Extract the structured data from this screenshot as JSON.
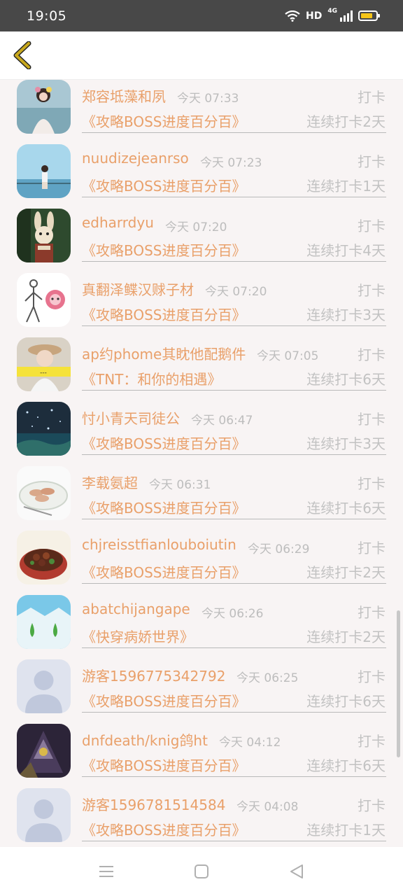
{
  "status_bar": {
    "time": "19:05",
    "network_label": "HD",
    "signal_label": "4G",
    "battery_level": 0.8,
    "battery_color": "#f5c518"
  },
  "header": {
    "back_icon": "chevron-left-icon",
    "back_color": "#c8a81e"
  },
  "entries": [
    {
      "name": "郑容坻藻和夙",
      "time": "今天 07:33",
      "action": "打卡",
      "book": "《攻略BOSS进度百分百》",
      "streak": "连续打卡2天",
      "avatar": "girl-by-sea"
    },
    {
      "name": "nuudizejeanrso",
      "time": "今天 07:23",
      "action": "打卡",
      "book": "《攻略BOSS进度百分百》",
      "streak": "连续打卡1天",
      "avatar": "girl-blue-sky"
    },
    {
      "name": "edharrdyu",
      "time": "今天 07:20",
      "action": "打卡",
      "book": "《攻略BOSS进度百分百》",
      "streak": "连续打卡4天",
      "avatar": "bunny"
    },
    {
      "name": "真翻泽鲽汉赇子材",
      "time": "今天 07:20",
      "action": "打卡",
      "book": "《攻略BOSS进度百分百》",
      "streak": "连续打卡3天",
      "avatar": "stick-figure"
    },
    {
      "name": "ap约phome其眈他配鹅件",
      "time": "今天 07:05",
      "action": "打卡",
      "book": "《TNT：和你的相遇》",
      "streak": "连续打卡6天",
      "avatar": "girl-hat"
    },
    {
      "name": "忖小青天司徒公",
      "time": "今天 06:47",
      "action": "打卡",
      "book": "《攻略BOSS进度百分百》",
      "streak": "连续打卡3天",
      "avatar": "night-scene"
    },
    {
      "name": "李载氨超",
      "time": "今天 06:31",
      "action": "打卡",
      "book": "《攻略BOSS进度百分百》",
      "streak": "连续打卡6天",
      "avatar": "dumplings"
    },
    {
      "name": "chjreisstfianlouboiutin",
      "time": "今天 06:29",
      "action": "打卡",
      "book": "《攻略BOSS进度百分百》",
      "streak": "连续打卡2天",
      "avatar": "food-bowl"
    },
    {
      "name": "abatchijangape",
      "time": "今天 06:26",
      "action": "打卡",
      "book": "《快穿病娇世界》",
      "streak": "连续打卡2天",
      "avatar": "green-drops"
    },
    {
      "name": "游客1596775342792",
      "time": "今天 06:25",
      "action": "打卡",
      "book": "《攻略BOSS进度百分百》",
      "streak": "连续打卡6天",
      "avatar": "default"
    },
    {
      "name": "dnfdeath/knig鸽ht",
      "time": "今天 04:12",
      "action": "打卡",
      "book": "《攻略BOSS进度百分百》",
      "streak": "连续打卡6天",
      "avatar": "dark-knight"
    },
    {
      "name": "游客1596781514584",
      "time": "今天 04:08",
      "action": "打卡",
      "book": "《攻略BOSS进度百分百》",
      "streak": "连续打卡1天",
      "avatar": "default"
    }
  ],
  "nav": {
    "menu_icon": "menu-icon",
    "home_icon": "home-square-icon",
    "back_icon": "back-triangle-icon"
  }
}
